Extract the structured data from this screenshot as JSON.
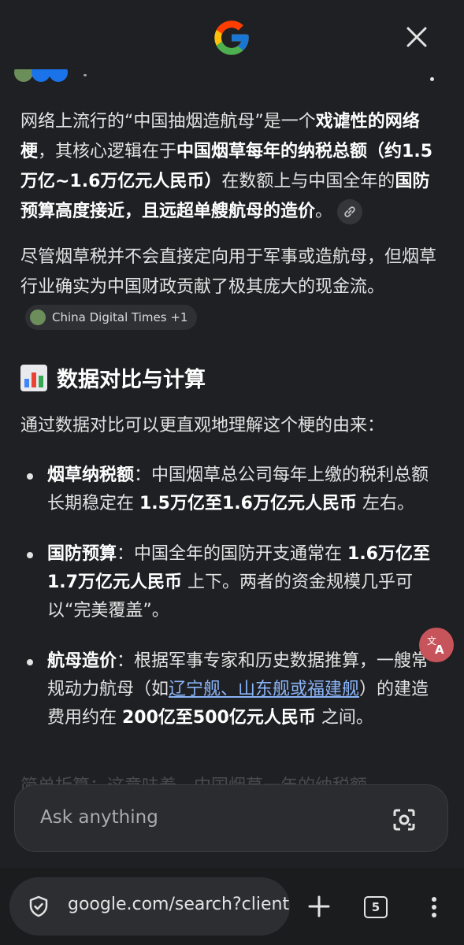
{
  "header": {
    "logo": "google-g-logo",
    "close_icon": "close-icon"
  },
  "answer": {
    "p1": [
      {
        "t": "网络上流行的“中国抽烟造航母”是一个"
      },
      {
        "t": "戏谑性的网络梗",
        "b": true
      },
      {
        "t": "，其核心逻辑在于"
      },
      {
        "t": "中国烟草每年的纳税总额（约1.5万亿~1.6万亿元人民币）",
        "b": true
      },
      {
        "t": "在数额上与中国全年的"
      },
      {
        "t": "国防预算高度接近，且远超单艘航母的造价",
        "b": true
      },
      {
        "t": "。"
      }
    ],
    "p2_text": "尽管烟草税并不会直接定向用于军事或造航母，但烟草行业确实为中国财政贡献了极其庞大的现金流。",
    "p2_source": "China Digital Times +1",
    "heading": "数据对比与计算",
    "intro": "通过数据对比可以更直观地理解这个梗的由来：",
    "bullets": [
      [
        {
          "t": "烟草纳税额",
          "b": true
        },
        {
          "t": "：中国烟草总公司每年上缴的税利总额长期稳定在 "
        },
        {
          "t": "1.5万亿至1.6万亿元人民币",
          "b": true
        },
        {
          "t": " 左右。"
        }
      ],
      [
        {
          "t": "国防预算",
          "b": true
        },
        {
          "t": "：中国全年的国防开支通常在 "
        },
        {
          "t": "1.6万亿至1.7万亿元人民币",
          "b": true
        },
        {
          "t": " 上下。两者的资金规模几乎可以“完美覆盖”。"
        }
      ],
      [
        {
          "t": "航母造价",
          "b": true
        },
        {
          "t": "：根据军事专家和历史数据推算，一艘常规动力航母（如"
        },
        {
          "t": "辽宁舰、山东舰或福建舰",
          "l": true
        },
        {
          "t": "）的建造费用约在 "
        },
        {
          "t": "200亿至500亿元人民币",
          "b": true
        },
        {
          "t": " 之间。"
        }
      ]
    ],
    "faded_text": "简单折算：这意味着，中国烟草一年的纳税额"
  },
  "ask": {
    "placeholder": "Ask anything"
  },
  "browser": {
    "url": "google.com/search?client",
    "tab_count": "5"
  }
}
